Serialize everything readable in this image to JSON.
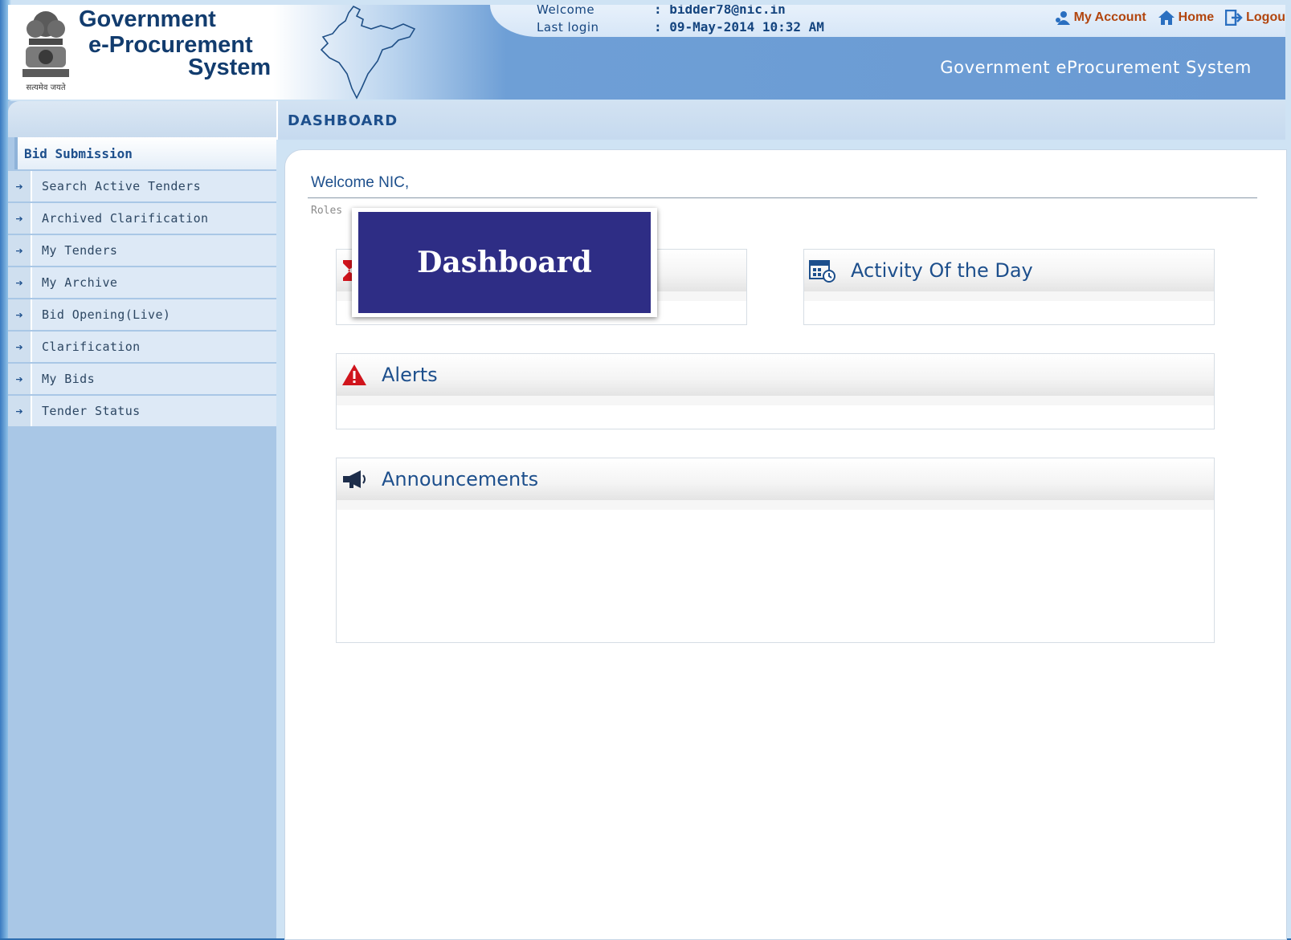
{
  "header": {
    "title_line1": "Government",
    "title_line2": "e-Procurement",
    "title_line3": "System",
    "emblem_motto": "सत्यमेव जयते",
    "welcome_label": "Welcome",
    "welcome_value": ": bidder78@nic.in",
    "lastlogin_label": "Last login",
    "lastlogin_value": ": 09-May-2014 10:32 AM",
    "links": {
      "my_account": "My  Account",
      "home": "Home",
      "logout": "Logou"
    },
    "system_name": "Government eProcurement System"
  },
  "sidebar": {
    "heading": "Bid Submission",
    "items": [
      {
        "label": "Search Active Tenders"
      },
      {
        "label": "Archived Clarification"
      },
      {
        "label": "My Tenders"
      },
      {
        "label": "My Archive"
      },
      {
        "label": "Bid Opening(Live)"
      },
      {
        "label": "Clarification"
      },
      {
        "label": "My Bids"
      },
      {
        "label": "Tender Status"
      }
    ]
  },
  "breadcrumb": "DASHBOARD",
  "main": {
    "welcome": "Welcome NIC,",
    "roles": "Roles",
    "panels": {
      "activity": "Activity Of the Day",
      "alerts": "Alerts",
      "announcements": "Announcements"
    }
  },
  "overlay": {
    "label": "Dashboard"
  },
  "colors": {
    "header_text": "#123c6e",
    "link": "#b2450e",
    "overlay_bg": "#2e2d85",
    "accent": "#1d4f8c",
    "alert": "#d0141c"
  }
}
